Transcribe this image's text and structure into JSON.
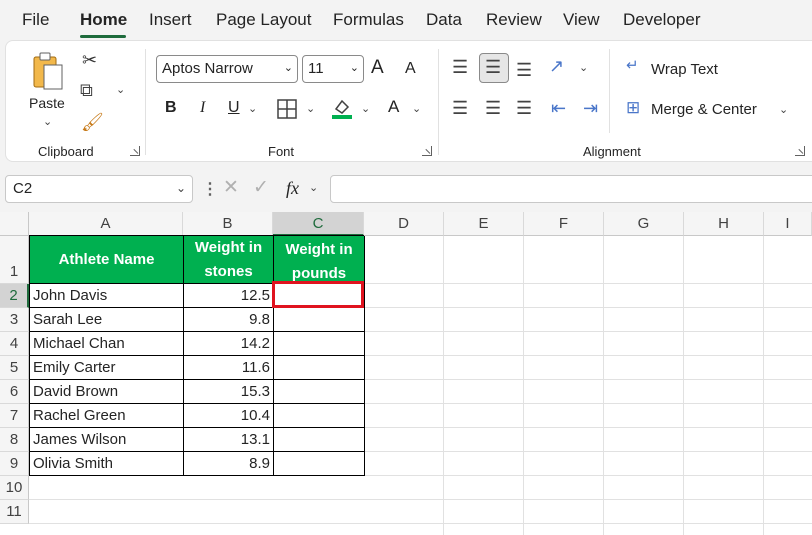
{
  "menu": {
    "items": [
      "File",
      "Home",
      "Insert",
      "Page Layout",
      "Formulas",
      "Data",
      "Review",
      "View",
      "Developer"
    ],
    "active": "Home"
  },
  "ribbon": {
    "clipboard": {
      "paste_label": "Paste",
      "group_label": "Clipboard"
    },
    "font": {
      "font_name": "Aptos Narrow",
      "font_size": "11",
      "group_label": "Font",
      "bold": "B",
      "italic": "I",
      "underline": "U",
      "font_color_glyph": "A",
      "grow": "A",
      "shrink": "A"
    },
    "alignment": {
      "wrap_text": "Wrap Text",
      "merge_center": "Merge & Center",
      "group_label": "Alignment"
    }
  },
  "formula_bar": {
    "name_box": "C2",
    "fx": "fx",
    "formula": ""
  },
  "sheet": {
    "columns": [
      "A",
      "B",
      "C",
      "D",
      "E",
      "F",
      "G",
      "H",
      "I"
    ],
    "rows": [
      "1",
      "2",
      "3",
      "4",
      "5",
      "6",
      "7",
      "8",
      "9",
      "10",
      "11"
    ],
    "selected_column": "C",
    "selected_row": "2",
    "headers": {
      "athlete": "Athlete Name",
      "stones_line1": "Weight in",
      "stones_line2": "stones",
      "pounds_line1": "Weight in",
      "pounds_line2": "pounds"
    },
    "data": [
      {
        "name": "John Davis",
        "stones": "12.5",
        "pounds": ""
      },
      {
        "name": "Sarah Lee",
        "stones": "9.8",
        "pounds": ""
      },
      {
        "name": "Michael Chan",
        "stones": "14.2",
        "pounds": ""
      },
      {
        "name": "Emily Carter",
        "stones": "11.6",
        "pounds": ""
      },
      {
        "name": "David Brown",
        "stones": "15.3",
        "pounds": ""
      },
      {
        "name": "Rachel Green",
        "stones": "10.4",
        "pounds": ""
      },
      {
        "name": "James Wilson",
        "stones": "13.1",
        "pounds": ""
      },
      {
        "name": "Olivia Smith",
        "stones": "8.9",
        "pounds": ""
      }
    ]
  },
  "colors": {
    "header_fill": "#00b050",
    "selection": "#e0131f",
    "accent": "#1e6b3c"
  }
}
